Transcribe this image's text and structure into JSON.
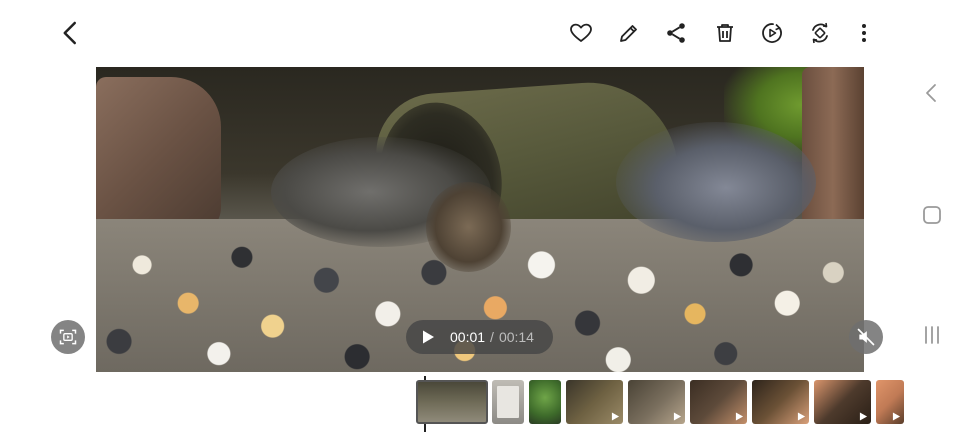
{
  "toolbar": {
    "back_icon": "chevron-left-icon",
    "icons": [
      "heart-icon",
      "pencil-icon",
      "share-icon",
      "trash-icon",
      "play-circle-icon",
      "rotate-icon",
      "more-vert-icon"
    ]
  },
  "player": {
    "current_time": "00:01",
    "separator": "/",
    "total_time": "00:14",
    "play_icon": "play-icon",
    "capture_icon": "video-capture-icon",
    "mute_icon": "volume-muted-icon"
  },
  "filmstrip": {
    "thumbnails": [
      {
        "kind": "video",
        "current": true,
        "color": "#5b5a48"
      },
      {
        "kind": "document",
        "current": false,
        "color": "#8c8a85"
      },
      {
        "kind": "image",
        "current": false,
        "color": "#4f7b3a"
      },
      {
        "kind": "video",
        "current": false,
        "color": "#6e6142"
      },
      {
        "kind": "video",
        "current": false,
        "color": "#7a6f5e"
      },
      {
        "kind": "video",
        "current": false,
        "color": "#5d4a3a"
      },
      {
        "kind": "video",
        "current": false,
        "color": "#6b5136"
      },
      {
        "kind": "video",
        "current": false,
        "color": "#4d3a2c"
      },
      {
        "kind": "video",
        "current": false,
        "color": "#c07a55"
      }
    ]
  },
  "navbar": {
    "back_icon": "nav-back-icon",
    "home_icon": "nav-home-icon",
    "recents_icon": "nav-recents-icon"
  },
  "colors": {
    "icon": "#222222",
    "nav_icon": "#9a9a9a",
    "pill_bg": "#464646"
  }
}
